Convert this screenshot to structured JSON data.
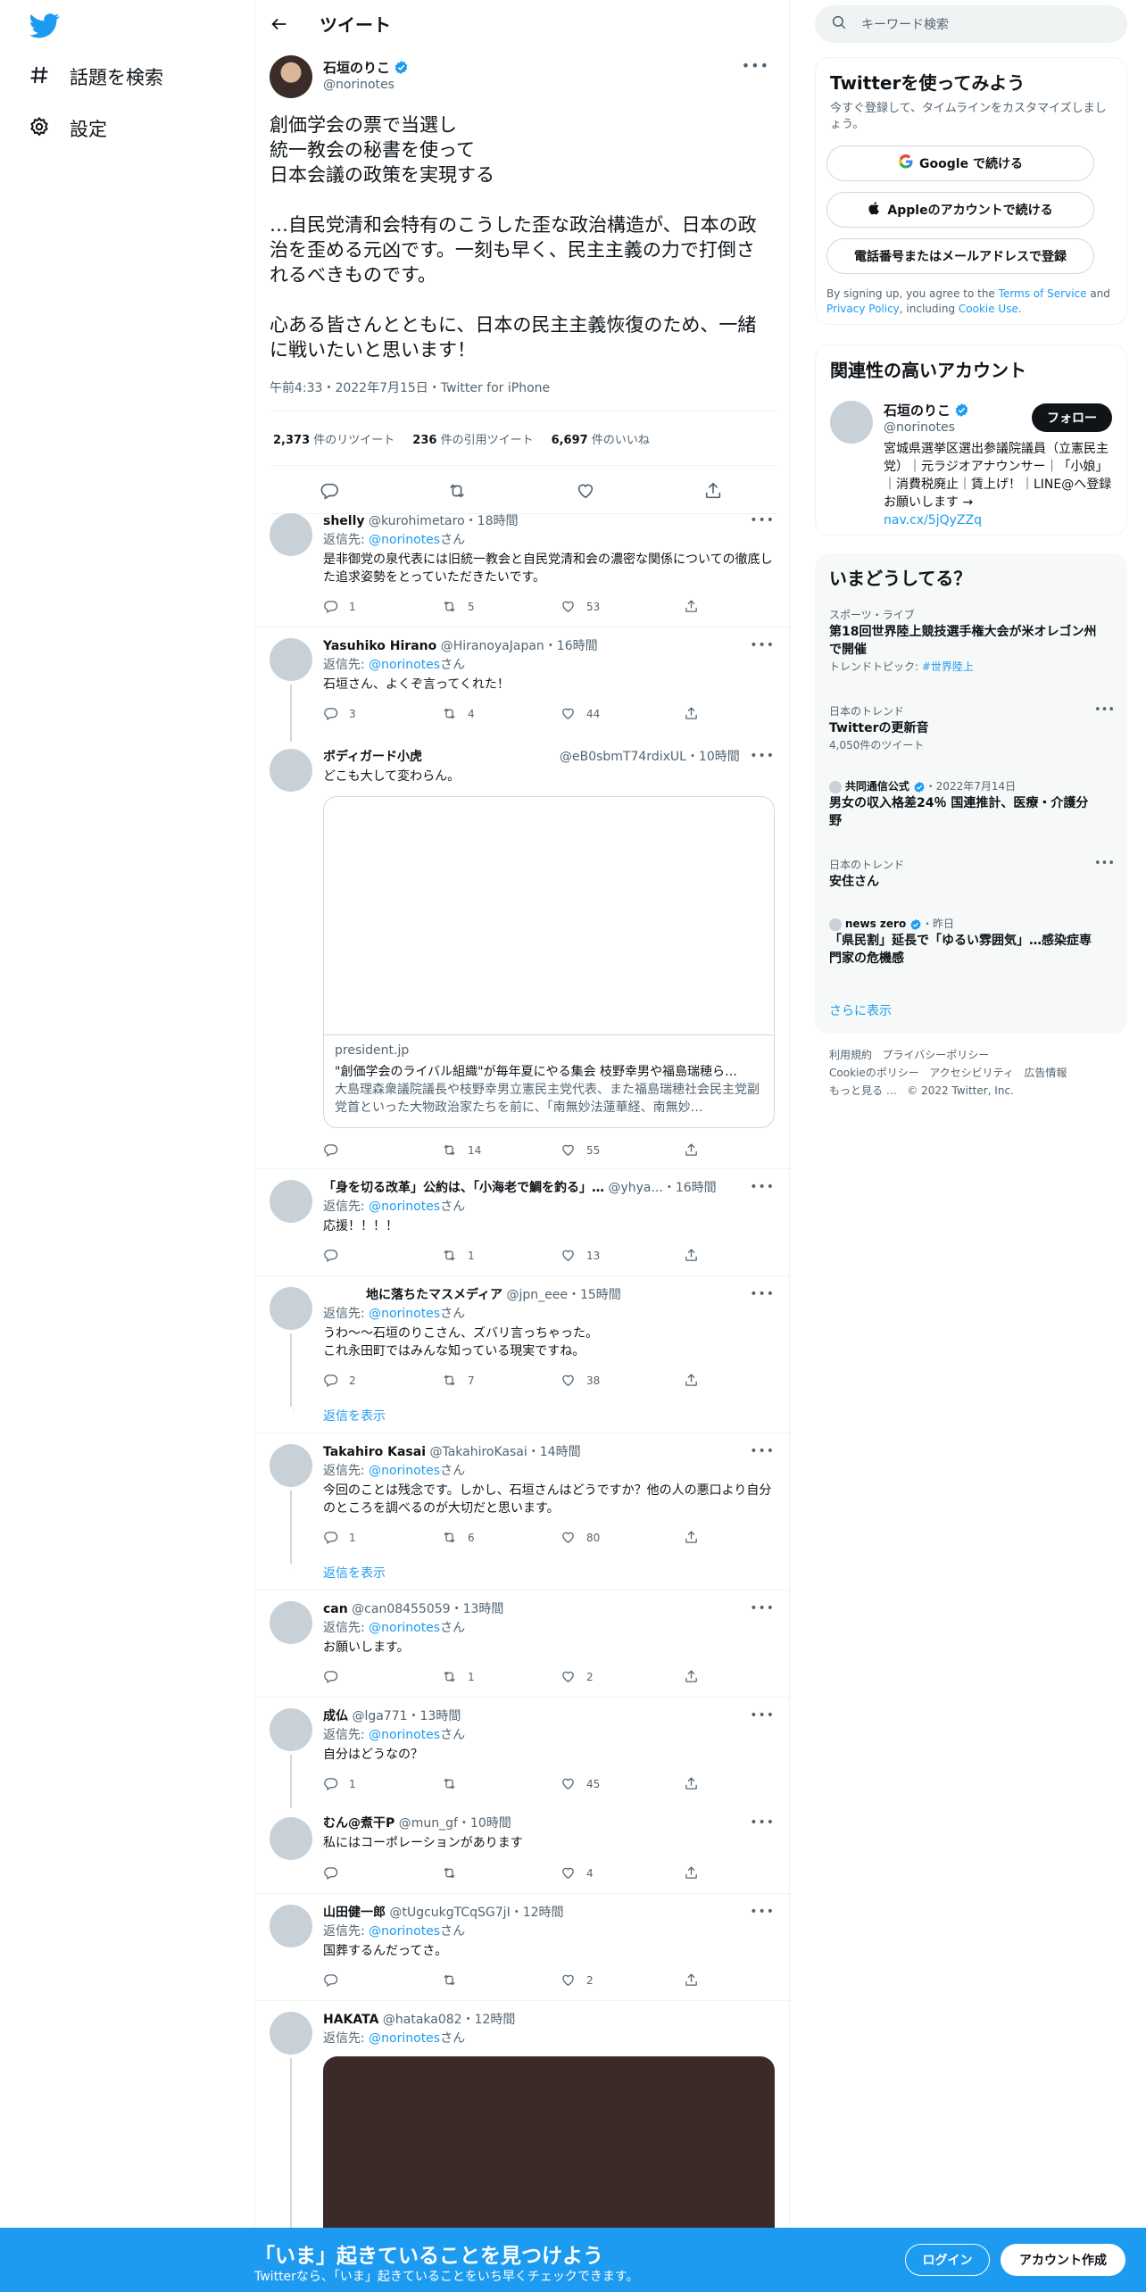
{
  "nav": {
    "explore": "話題を検索",
    "settings": "設定"
  },
  "header": {
    "title": "ツイート"
  },
  "focal": {
    "name": "石垣のりこ",
    "handle": "@norinotes",
    "text": "創価学会の票で当選し\n統一教会の秘書を使って\n日本会議の政策を実現する\n\n…自民党清和会特有のこうした歪な政治構造が、日本の政治を歪める元凶です。一刻も早く、民主主義の力で打倒されるべきものです。\n\n心ある皆さんとともに、日本の民主主義恢復のため、一緒に戦いたいと思います！",
    "meta": "午前4:33・2022年7月15日・Twitter for iPhone",
    "retweets": "2,373",
    "retweets_label": "件のリツイート",
    "quotes": "236",
    "quotes_label": "件の引用ツイート",
    "likes": "6,697",
    "likes_label": "件のいいね"
  },
  "replying_prefix": "返信先: ",
  "replying_to": "@norinotes",
  "replying_suffix": "さん",
  "show_replies": "返信を表示",
  "replies": [
    {
      "name": "shelly",
      "handle": "@kurohimetaro",
      "time": "・18時間",
      "text": "是非御党の泉代表には旧統一教会と自民党清和会の濃密な関係についての徹底した追求姿勢をとっていただきたいです。",
      "reply": "1",
      "rt": "5",
      "like": "53"
    },
    {
      "name": "Yasuhiko Hirano",
      "handle": "@HiranoyaJapan",
      "time": "・16時間",
      "text": "石垣さん、よくぞ言ってくれた！",
      "reply": "3",
      "rt": "4",
      "like": "44"
    },
    {
      "name": "ボディガード小虎",
      "handle": "@eB0sbmT74rdixUL",
      "time": "・10時間",
      "text": "どこも大して変わらん。",
      "reply": "",
      "rt": "14",
      "like": "55",
      "card": {
        "domain": "president.jp",
        "title": "\"創価学会のライバル組織\"が毎年夏にやる集会 枝野幸男や福島瑞穂ら…",
        "desc": "大島理森衆議院議長や枝野幸男立憲民主党代表、また福島瑞穂社会民主党副党首といった大物政治家たちを前に、「南無妙法蓮華経、南無妙…"
      }
    },
    {
      "name": "「身を切る改革」公約は、「小海老で鯛を釣る」…",
      "handle": "@yhya...",
      "time": "・16時間",
      "text": "応援！！！！",
      "reply": "",
      "rt": "1",
      "like": "13"
    },
    {
      "name": "地に落ちたマスメディア",
      "handle": "@jpn_eee",
      "time": "・15時間",
      "text": "うわ～～石垣のりこさん、ズバリ言っちゃった。\nこれ永田町ではみんな知っている現実ですね。",
      "reply": "2",
      "rt": "7",
      "like": "38"
    },
    {
      "name": "Takahiro Kasai",
      "handle": "@TakahiroKasai",
      "time": "・14時間",
      "text": "今回のことは残念です。しかし、石垣さんはどうですか？他の人の悪口より自分のところを調べるのが大切だと思います。",
      "reply": "1",
      "rt": "6",
      "like": "80"
    },
    {
      "name": "can",
      "handle": "@can08455059",
      "time": "・13時間",
      "text": "お願いします。",
      "reply": "",
      "rt": "1",
      "like": "2"
    },
    {
      "name": "成仏",
      "handle": "@lga771",
      "time": "・13時間",
      "text": "自分はどうなの？",
      "reply": "1",
      "rt": "",
      "like": "45"
    },
    {
      "name": "むん@煮干P",
      "handle": "@mun_gf",
      "time": "・10時間",
      "text": "私にはコーポレーションがあります",
      "reply": "",
      "rt": "",
      "like": "4"
    },
    {
      "name": "山田健一郎",
      "handle": "@tUgcukgTCqSG7jI",
      "time": "・12時間",
      "text": "国葬するんだってさ。",
      "reply": "",
      "rt": "",
      "like": "2"
    },
    {
      "name": "HAKATA",
      "handle": "@hataka082",
      "time": "・12時間",
      "text": "",
      "reply": "",
      "rt": "",
      "like": ""
    }
  ],
  "search": {
    "placeholder": "キーワード検索"
  },
  "signup": {
    "title": "Twitterを使ってみよう",
    "sub": "今すぐ登録して、タイムラインをカスタマイズしましょう。",
    "google": "Google で続ける",
    "apple": "Appleのアカウントで続ける",
    "phone": "電話番号またはメールアドレスで登録",
    "terms_a": "By signing up, you agree to the ",
    "terms_link1": "Terms of Service",
    "terms_b": " and ",
    "terms_link2": "Privacy Policy",
    "terms_c": ", including ",
    "terms_link3": "Cookie Use",
    "terms_d": "."
  },
  "related": {
    "title": "関連性の高いアカウント",
    "name": "石垣のりこ",
    "handle": "@norinotes",
    "follow": "フォロー",
    "bio": "宮城県選挙区選出参議院議員（立憲民主党）｜元ラジオアナウンサー｜「小娘」｜消費税廃止｜賃上げ！｜LINE@へ登録お願いします →",
    "link": "nav.cx/5jQyZZq"
  },
  "trends": {
    "title": "いまどうしてる？",
    "items": [
      {
        "cat": "スポーツ・ライブ",
        "title": "第18回世界陸上競技選手権大会が米オレゴン州で開催",
        "tag_label": "トレンドトピック: ",
        "tag": "#世界陸上"
      },
      {
        "cat": "日本のトレンド",
        "title": "Twitterの更新音",
        "count": "4,050件のツイート"
      },
      {
        "source": "共同通信公式",
        "date": "・2022年7月14日",
        "title": "男女の収入格差24％ 国連推計、医療・介護分野"
      },
      {
        "cat": "日本のトレンド",
        "title": "安住さん"
      },
      {
        "source": "news zero",
        "date": "・昨日",
        "title": "「県民割」延長で「ゆるい雰囲気」…感染症専門家の危機感"
      }
    ],
    "show_more": "さらに表示"
  },
  "footer": {
    "links": [
      "利用規約",
      "プライバシーポリシー",
      "Cookieのポリシー",
      "アクセシビリティ",
      "広告情報",
      "もっと見る …"
    ],
    "copyright": "© 2022 Twitter, Inc."
  },
  "bottombar": {
    "title": "「いま」起きていることを見つけよう",
    "sub": "Twitterなら、「いま」起きていることをいち早くチェックできます。",
    "login": "ログイン",
    "signup": "アカウント作成"
  },
  "colors": {
    "accent": "#1d9bf0",
    "text": "#0f1419",
    "muted": "#536471"
  }
}
